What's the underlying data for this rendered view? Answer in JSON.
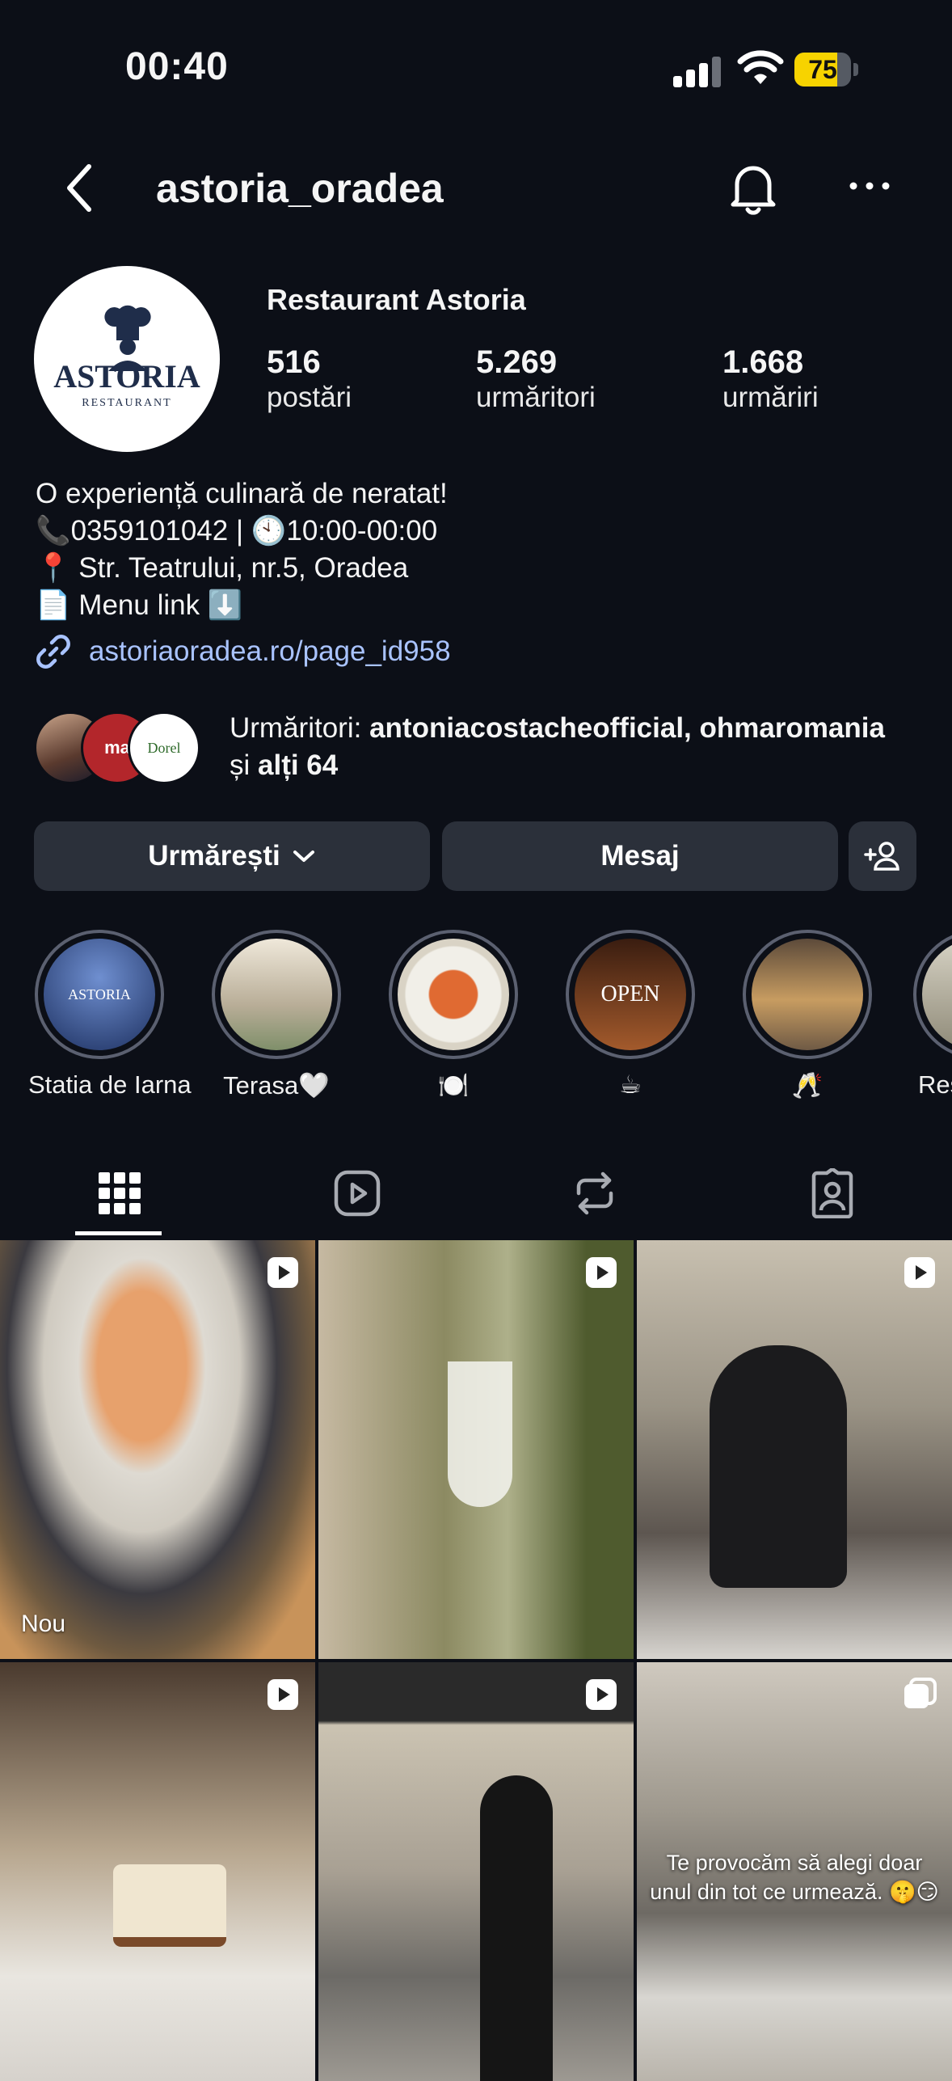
{
  "status_bar": {
    "time": "00:40",
    "battery": "75",
    "battery_level": 0.75
  },
  "header": {
    "username": "astoria_oradea"
  },
  "profile": {
    "display_name": "Restaurant Astoria",
    "avatar_logo_text": "ASTORIA",
    "avatar_logo_sub": "RESTAURANT",
    "stats": [
      {
        "value": "516",
        "label": "postări"
      },
      {
        "value": "5.269",
        "label": "urmăritori"
      },
      {
        "value": "1.668",
        "label": "urmăriri"
      }
    ],
    "bio": [
      "O experiență culinară de neratat!",
      "📞0359101042 | 🕙10:00-00:00",
      "📍 Str. Teatrului, nr.5, Oradea",
      "📄 Menu link ⬇️"
    ],
    "link": "astoriaoradea.ro/page_id958",
    "followed_by": {
      "prefix": "Urmăritori: ",
      "names": "antoniacostacheofficial, ohmaromania",
      "suffix_a": "și ",
      "suffix_b": "alți 64",
      "avatar_2_text": "ma",
      "avatar_3_text": "Dorel"
    }
  },
  "actions": {
    "follow_label": "Urmărești",
    "message_label": "Mesaj"
  },
  "highlights": [
    {
      "caption": "Statia de Iarna",
      "thumb_text": "ASTORIA",
      "color": "#3b5ba0"
    },
    {
      "caption": "Terasa🤍",
      "thumb_text": "",
      "color": "#d9d1c1"
    },
    {
      "caption": "🍽️",
      "thumb_text": "",
      "color": "#c9502a"
    },
    {
      "caption": "☕",
      "thumb_text": "OPEN",
      "color": "#7a3f22"
    },
    {
      "caption": "🥂",
      "thumb_text": "",
      "color": "#8a6b47"
    },
    {
      "caption": "Rest",
      "thumb_text": "",
      "color": "#b9b5a7"
    }
  ],
  "tabs": [
    "grid",
    "reels",
    "reposts",
    "tagged"
  ],
  "grid": [
    {
      "type": "reel",
      "label": "Nou",
      "overlay": ""
    },
    {
      "type": "reel",
      "label": "",
      "overlay": ""
    },
    {
      "type": "reel",
      "label": "",
      "overlay": ""
    },
    {
      "type": "reel",
      "label": "",
      "overlay": ""
    },
    {
      "type": "reel",
      "label": "",
      "overlay": ""
    },
    {
      "type": "carousel",
      "label": "",
      "overlay": "Te provocăm să alegi doar unul din tot ce urmează. 🤫😏"
    }
  ]
}
